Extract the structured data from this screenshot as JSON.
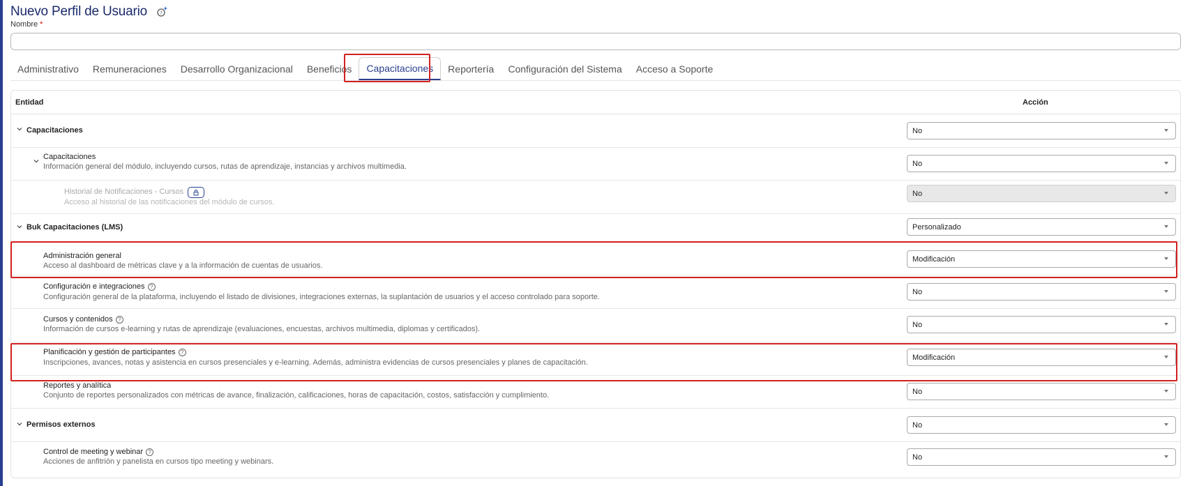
{
  "header": {
    "title": "Nuevo Perfil de Usuario",
    "icon": "magic-wand-icon"
  },
  "form": {
    "name_label": "Nombre",
    "required_mark": "*",
    "name_value": "",
    "name_placeholder": ""
  },
  "tabs": [
    {
      "label": "Administrativo",
      "active": false
    },
    {
      "label": "Remuneraciones",
      "active": false
    },
    {
      "label": "Desarrollo Organizacional",
      "active": false
    },
    {
      "label": "Beneficios",
      "active": false
    },
    {
      "label": "Capacitaciones",
      "active": true
    },
    {
      "label": "Reportería",
      "active": false
    },
    {
      "label": "Configuración del Sistema",
      "active": false
    },
    {
      "label": "Acceso a Soporte",
      "active": false
    }
  ],
  "table": {
    "col_entity": "Entidad",
    "col_action": "Acción",
    "rows": [
      {
        "name": "Capacitaciones",
        "desc": "",
        "value": "No"
      },
      {
        "name": "Capacitaciones",
        "desc": "Información general del módulo, incluyendo cursos, rutas de aprendizaje, instancias y archivos multimedia.",
        "value": "No"
      },
      {
        "name": "Historial de Notificaciones - Cursos",
        "desc": "Acceso al historial de las notificaciones del módulo de cursos.",
        "value": "No",
        "locked": true
      },
      {
        "name": "Buk Capacitaciones (LMS)",
        "desc": "",
        "value": "Personalizado"
      },
      {
        "name": "Administración general",
        "desc": "Acceso al dashboard de métricas clave y a la información de cuentas de usuarios.",
        "value": "Modificación"
      },
      {
        "name": "Configuración e integraciones",
        "desc": "Configuración general de la plataforma, incluyendo el listado de divisiones, integraciones externas, la suplantación de usuarios y el acceso controlado para soporte.",
        "value": "No"
      },
      {
        "name": "Cursos y contenidos",
        "desc": "Información de cursos e-learning y rutas de aprendizaje (evaluaciones, encuestas, archivos multimedia, diplomas y certificados).",
        "value": "No"
      },
      {
        "name": "Planificación y gestión de participantes",
        "desc": "Inscripciones, avances, notas y asistencia en cursos presenciales y e-learning. Además, administra evidencias de cursos presenciales y planes de capacitación.",
        "value": "Modificación"
      },
      {
        "name": "Reportes y analítica",
        "desc": "Conjunto de reportes personalizados con métricas de avance, finalización, calificaciones, horas de capacitación, costos, satisfacción y cumplimiento.",
        "value": "No"
      },
      {
        "name": "Permisos externos",
        "desc": "",
        "value": "No"
      },
      {
        "name": "Control de meeting y webinar",
        "desc": "Acciones de anfitrión y panelista en cursos tipo meeting y webinars.",
        "value": "No"
      }
    ]
  },
  "colors": {
    "accent": "#2a3f8f",
    "highlight": "#d32020"
  }
}
